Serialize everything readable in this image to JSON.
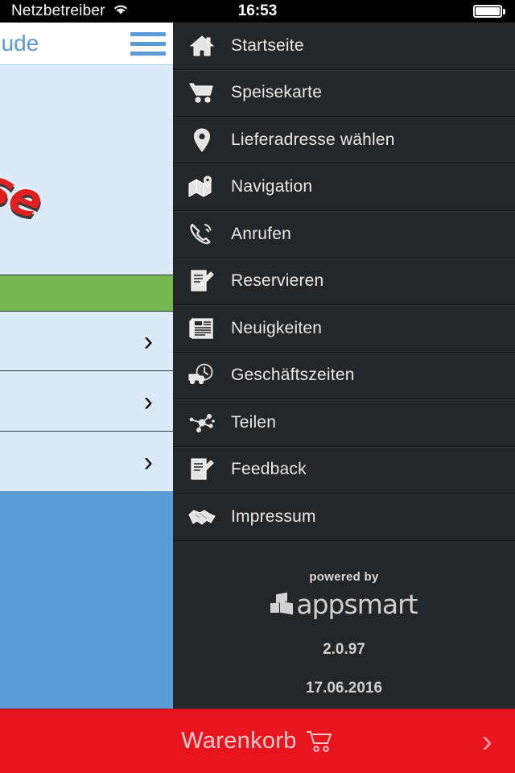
{
  "status_bar": {
    "carrier": "Netzbetreiber",
    "wifi_icon": "wifi-icon",
    "time": "16:53",
    "battery_icon": "battery-full-icon"
  },
  "app_behind": {
    "title": "nude",
    "menu_icon": "hamburger-icon",
    "logo_text": "use",
    "rows": [
      {
        "chevron": "›"
      },
      {
        "chevron": "›"
      },
      {
        "chevron": "›"
      }
    ],
    "colors": {
      "accent_blue": "#5b9bd5",
      "panel_blue": "#dce9f6",
      "green": "#76b852",
      "logo_red": "#e02020"
    }
  },
  "drawer": {
    "background": "#252628",
    "items": [
      {
        "label": "Startseite",
        "icon": "home-icon"
      },
      {
        "label": "Speisekarte",
        "icon": "shopping-cart-icon"
      },
      {
        "label": "Lieferadresse wählen",
        "icon": "location-pin-icon"
      },
      {
        "label": "Navigation",
        "icon": "map-icon"
      },
      {
        "label": "Anrufen",
        "icon": "phone-icon"
      },
      {
        "label": "Reservieren",
        "icon": "document-pencil-icon"
      },
      {
        "label": "Neuigkeiten",
        "icon": "newspaper-icon"
      },
      {
        "label": "Geschäftszeiten",
        "icon": "truck-clock-icon"
      },
      {
        "label": "Teilen",
        "icon": "share-nodes-icon"
      },
      {
        "label": "Feedback",
        "icon": "document-pencil-icon"
      },
      {
        "label": "Impressum",
        "icon": "handshake-icon"
      }
    ],
    "footer": {
      "powered_by": "powered by",
      "brand_first": "app",
      "brand_second": "smart",
      "version": "2.0.97",
      "date": "17.06.2016"
    }
  },
  "cart_bar": {
    "label": "Warenkorb",
    "cart_icon": "shopping-cart-icon",
    "chevron": "›",
    "color": "#e8141e"
  }
}
